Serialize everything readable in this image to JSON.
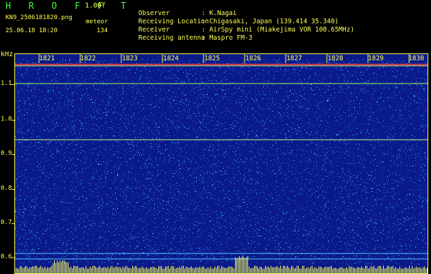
{
  "app": {
    "name": "H R O F F T",
    "version": "1.00f"
  },
  "file": {
    "name": "KN9_2506181820.png",
    "datetime": "25.06.18 18:20"
  },
  "meteor": {
    "label": "meteor",
    "count": "134"
  },
  "info": [
    {
      "label": "Observer",
      "value": ": K.Nagai"
    },
    {
      "label": "Receiving Location",
      "value": ": Chigasaki, Japan (139.414 35.340)"
    },
    {
      "label": "Receiver",
      "value": ": AirSpy mini (Miakejima VOR 108.65MHz)"
    },
    {
      "label": "Receiving antenna",
      "value": ": Maspro FM-3"
    }
  ],
  "axis": {
    "y_unit": "kHz",
    "y_ticks": [
      "1.1",
      "1.0",
      "0.9",
      "0.8",
      "0.7",
      "0.6"
    ],
    "x_ticks": [
      "1821",
      "1822",
      "1823",
      "1824",
      "1825",
      "1826",
      "1827",
      "1828",
      "1829",
      "1830"
    ]
  },
  "colors": {
    "background": "#0a1a8a",
    "noise": "#29a0ff",
    "text": "#ffff55",
    "logo": "#3cff3c"
  }
}
